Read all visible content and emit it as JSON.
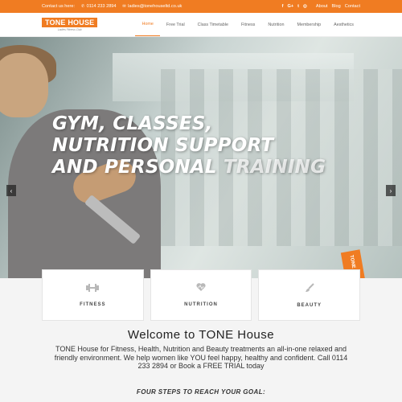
{
  "topbar": {
    "contact_label": "Contact us here:",
    "phone": "0114 233 2894",
    "email": "ladies@tonehouseltd.co.uk",
    "links": [
      "About",
      "Blog",
      "Contact"
    ]
  },
  "logo": {
    "brand": "TONE HOUSE",
    "tagline": "Ladies Fitness Club"
  },
  "nav": {
    "items": [
      "Home",
      "Free Trial",
      "Class Timetable",
      "Fitness",
      "Nutrition",
      "Membership",
      "Aesthetics"
    ],
    "active": "Home"
  },
  "hero": {
    "line1": "GYM, CLASSES,",
    "line2": "NUTRITION SUPPORT",
    "line3a": "AND PERSONAL ",
    "line3b": "TRAINING",
    "stamp": "TONE HOUSE",
    "prev": "‹",
    "next": "›"
  },
  "cards": [
    {
      "label": "FITNESS",
      "icon": "dumbbell-icon"
    },
    {
      "label": "NUTRITION",
      "icon": "heart-icon"
    },
    {
      "label": "BEAUTY",
      "icon": "brush-icon"
    }
  ],
  "welcome": {
    "title": "Welcome to TONE House",
    "text": "TONE House for Fitness, Health, Nutrition and Beauty treatments an all-in-one relaxed and friendly environment. We help women like YOU feel happy, healthy and confident. Call 0114 233 2894 or Book a FREE TRIAL today"
  },
  "steps": {
    "title": "FOUR STEPS TO REACH YOUR GOAL:"
  },
  "colors": {
    "accent": "#f07c22"
  }
}
